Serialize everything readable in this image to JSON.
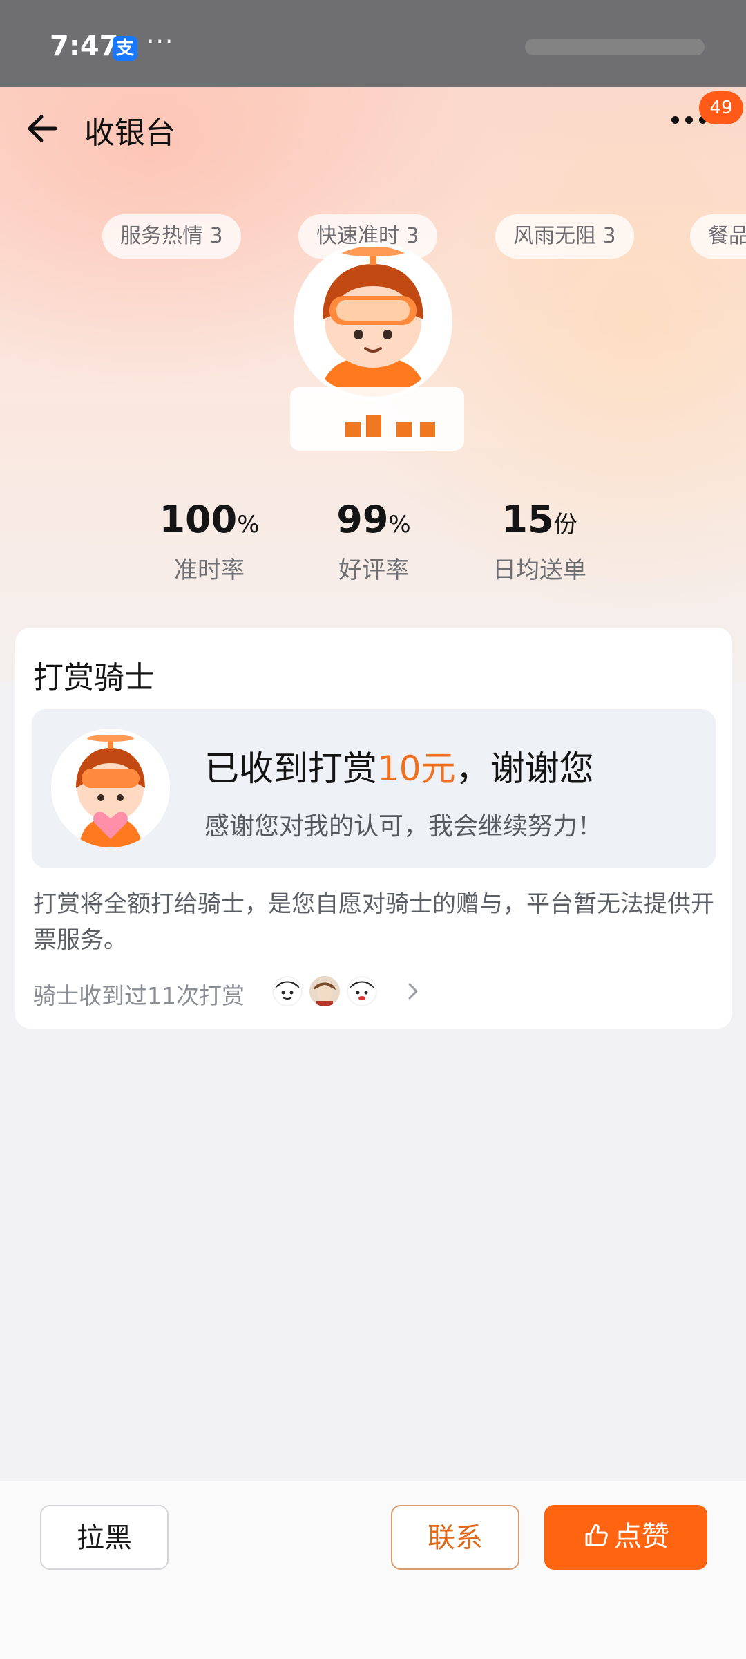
{
  "status_bar": {
    "time": "7:47",
    "app_icon": "alipay-icon",
    "app_icon_glyph": "支",
    "more": "···"
  },
  "navbar": {
    "title": "收银台",
    "back_icon": "back-arrow-icon",
    "more_icon": "more-dots-icon",
    "badge": "49"
  },
  "tags": [
    {
      "label": "服务热情 3"
    },
    {
      "label": "快速准时 3"
    },
    {
      "label": "风雨无阻 3"
    },
    {
      "label": "餐品"
    }
  ],
  "stats": [
    {
      "value": "100",
      "unit": "%",
      "label": "准时率"
    },
    {
      "value": "99",
      "unit": "%",
      "label": "好评率"
    },
    {
      "value": "15",
      "unit": "份",
      "label": "日均送单"
    }
  ],
  "tip_card": {
    "title": "打赏骑士",
    "main_prefix": "已收到打赏",
    "amount": "10元",
    "main_suffix": "，谢谢您",
    "sub": "感谢您对我的认可，我会继续努力！",
    "notice": "打赏将全额打给骑士，是您自愿对骑士的赠与，平台暂无法提供开票服务。",
    "count_text": "骑士收到过11次打赏"
  },
  "bottom_bar": {
    "block_label": "拉黑",
    "contact_label": "联系",
    "like_label": "点赞"
  },
  "colors": {
    "accent": "#ff6410",
    "amount": "#f07020",
    "badge": "#ff5a17"
  }
}
